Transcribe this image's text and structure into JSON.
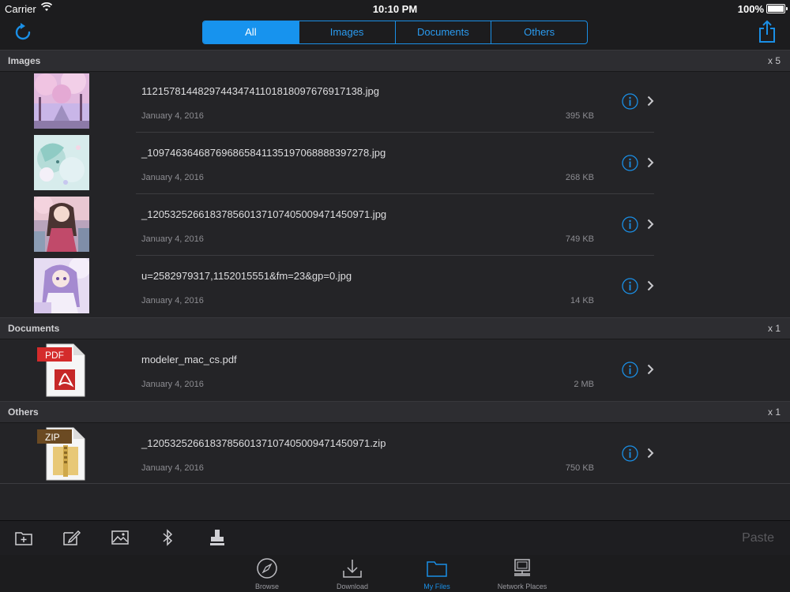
{
  "status_bar": {
    "carrier": "Carrier",
    "time": "10:10 PM",
    "battery": "100%"
  },
  "nav": {
    "refresh_icon": "refresh-icon",
    "share_icon": "share-icon",
    "segments": [
      {
        "label": "All",
        "selected": true
      },
      {
        "label": "Images",
        "selected": false
      },
      {
        "label": "Documents",
        "selected": false
      },
      {
        "label": "Others",
        "selected": false
      }
    ]
  },
  "sections": [
    {
      "title": "Images",
      "count": "x 5",
      "items": [
        {
          "name": "1121578144829744347411018180976769171​38.jpg",
          "date": "January 4, 2016",
          "size": "395 KB",
          "thumb": "image-thumbnail"
        },
        {
          "name": "_109746364687696865841135197068888397278.jpg",
          "date": "January 4, 2016",
          "size": "268 KB",
          "thumb": "image-thumbnail"
        },
        {
          "name": "_120532526618378560137107405009471450971.jpg",
          "date": "January 4, 2016",
          "size": "749 KB",
          "thumb": "image-thumbnail"
        },
        {
          "name": "u=2582979317,1152015551&fm=23&gp=0.jpg",
          "date": "January 4, 2016",
          "size": "14 KB",
          "thumb": "image-thumbnail"
        }
      ]
    },
    {
      "title": "Documents",
      "count": "x 1",
      "items": [
        {
          "name": "modeler_mac_cs.pdf",
          "date": "January 4, 2016",
          "size": "2 MB",
          "thumb": "pdf-file-icon",
          "badge": "PDF"
        }
      ]
    },
    {
      "title": "Others",
      "count": "x 1",
      "items": [
        {
          "name": "_120532526618378560137107405009471450971.zip",
          "date": "January 4, 2016",
          "size": "750 KB",
          "thumb": "zip-file-icon",
          "badge": "ZIP"
        }
      ]
    }
  ],
  "toolbar": {
    "icons": [
      "new-folder-icon",
      "edit-icon",
      "image-icon",
      "bluetooth-icon",
      "stamp-icon"
    ],
    "paste_label": "Paste"
  },
  "tabs": [
    {
      "label": "Browse",
      "icon": "compass-icon"
    },
    {
      "label": "Download",
      "icon": "download-icon"
    },
    {
      "label": "My Files",
      "icon": "folder-icon",
      "selected": true
    },
    {
      "label": "Network Places",
      "icon": "network-icon"
    }
  ],
  "colors": {
    "accent": "#1a8fe6",
    "background": "#242427",
    "bar": "#1c1c1e"
  }
}
